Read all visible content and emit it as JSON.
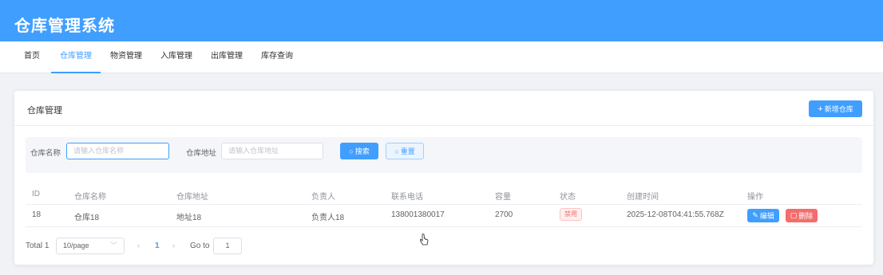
{
  "app": {
    "title": "仓库管理系统"
  },
  "nav": {
    "items": [
      {
        "label": "首页"
      },
      {
        "label": "仓库管理"
      },
      {
        "label": "物资管理"
      },
      {
        "label": "入库管理"
      },
      {
        "label": "出库管理"
      },
      {
        "label": "库存查询"
      }
    ],
    "active_index": 1
  },
  "card": {
    "title": "仓库管理",
    "add_button": "新增仓库"
  },
  "search": {
    "name_label": "仓库名称",
    "name_placeholder": "请输入仓库名称",
    "address_label": "仓库地址",
    "address_placeholder": "请输入仓库地址",
    "search_button": "搜索",
    "reset_button": "重置"
  },
  "table": {
    "columns": [
      "ID",
      "仓库名称",
      "仓库地址",
      "负责人",
      "联系电话",
      "容量",
      "状态",
      "创建时间",
      "操作"
    ],
    "rows": [
      {
        "id": "18",
        "name": "仓库18",
        "address": "地址18",
        "manager": "负责人18",
        "phone": "138001380017",
        "capacity": "2700",
        "status": "禁用",
        "created": "2025-12-08T04:41:55.768Z",
        "edit_label": "编辑",
        "delete_label": "删除"
      }
    ]
  },
  "pagination": {
    "total_text": "Total 1",
    "page_size": "10/page",
    "current_page": "1",
    "goto_label": "Go to",
    "goto_value": "1"
  },
  "colors": {
    "primary": "#409eff",
    "danger": "#f56c6c",
    "background": "#f0f2f5"
  }
}
